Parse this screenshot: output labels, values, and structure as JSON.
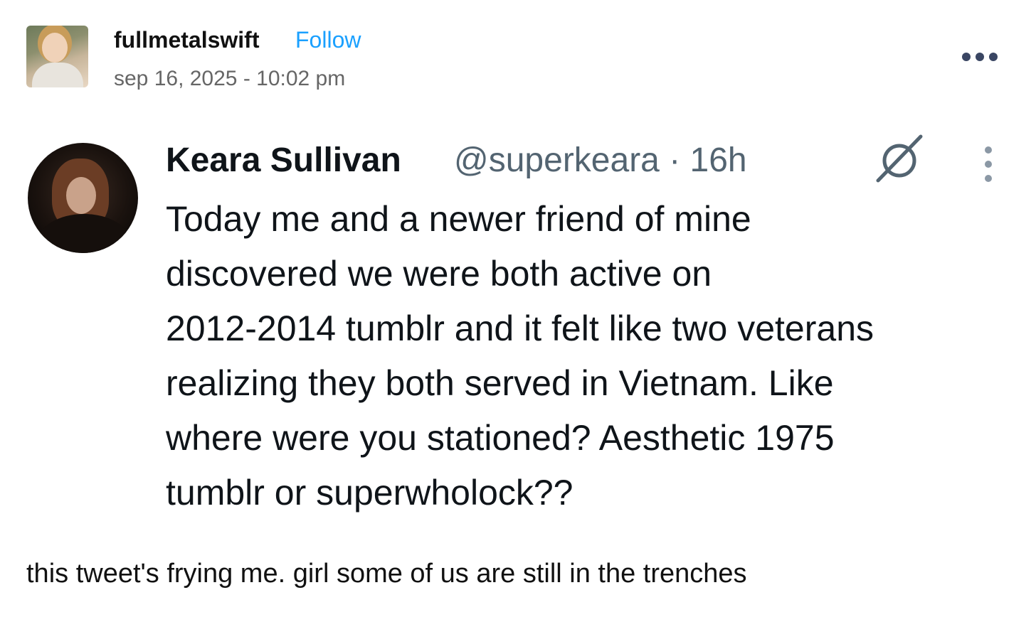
{
  "post": {
    "username": "fullmetalswift",
    "follow_label": "Follow",
    "timestamp": "sep 16, 2025 - 10:02 pm",
    "more_icon": "more-horizontal-icon",
    "caption": "this tweet's frying me. girl some of us are still in the trenches"
  },
  "tweet": {
    "display_name": "Keara Sullivan",
    "handle_time": "@superkeara · 16h",
    "grok_icon": "grok-icon",
    "more_icon": "more-vertical-icon",
    "lines": [
      "Today me and a newer friend of mine",
      "discovered we were both active on",
      "2012-2014 tumblr and it felt like two veterans",
      "realizing they both served in Vietnam. Like",
      "where were you stationed? Aesthetic 1975",
      "tumblr or superwholock??"
    ]
  },
  "colors": {
    "follow": "#1aa0ff",
    "tweet_text": "#0f1419",
    "tweet_secondary": "#536471",
    "timestamp": "#666666"
  }
}
